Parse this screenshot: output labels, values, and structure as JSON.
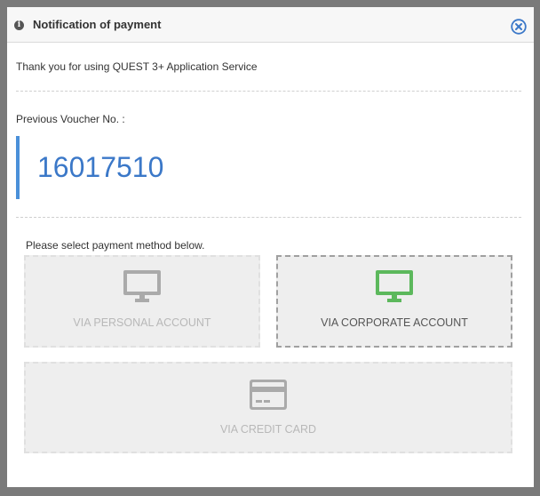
{
  "dialog": {
    "title": "Notification of payment",
    "thanks_text": "Thank you for using QUEST 3+ Application Service",
    "voucher_label": "Previous Voucher No. :",
    "voucher_number": "16017510",
    "select_text": "Please select payment method below."
  },
  "methods": {
    "personal": {
      "label": "VIA PERSONAL ACCOUNT",
      "icon": "monitor-icon",
      "selected": false
    },
    "corporate": {
      "label": "VIA CORPORATE ACCOUNT",
      "icon": "monitor-icon",
      "selected": true
    },
    "card": {
      "label": "VIA CREDIT CARD",
      "icon": "credit-card-icon",
      "selected": false
    }
  },
  "colors": {
    "accent_blue": "#3b78c8",
    "voucher_bar": "#4a90d9",
    "selected_icon": "#5cb85c",
    "inactive_icon": "#aaaaaa",
    "close_icon": "#3b78c8"
  }
}
